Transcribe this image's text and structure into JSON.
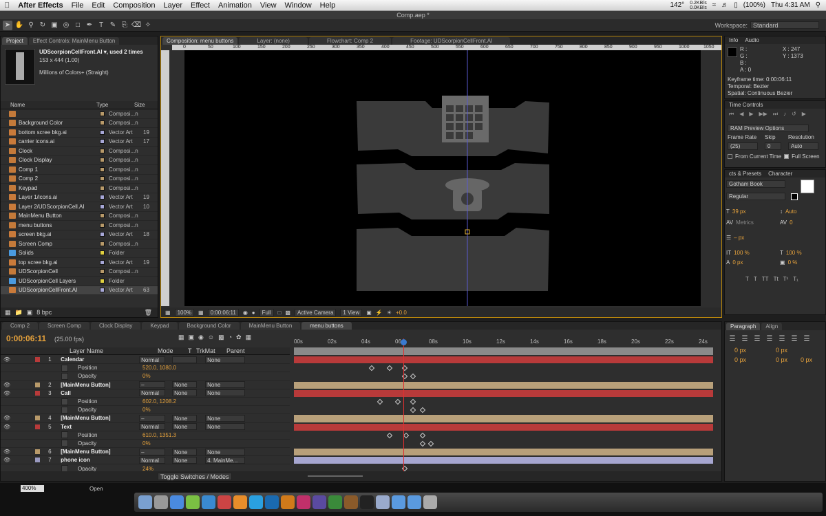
{
  "menubar": {
    "app_name": "After Effects",
    "items": [
      "File",
      "Edit",
      "Composition",
      "Layer",
      "Effect",
      "Animation",
      "View",
      "Window",
      "Help"
    ],
    "temp": "142°",
    "net_up": "0.2KB/s",
    "net_down": "0.0KB/s",
    "battery": "(100%)",
    "clock": "Thu 4:31 AM"
  },
  "window_title": "Comp.aep *",
  "workspace": {
    "label": "Workspace:",
    "value": "Standard"
  },
  "project": {
    "tabs": [
      "Project",
      "Effect Controls: MainMenu Button"
    ],
    "preview_name": "UDScorpionCellFront.AI ▾, used 2 times",
    "preview_dims": "153 x 444 (1.00)",
    "preview_color": "Millions of Colors+ (Straight)",
    "columns": {
      "name": "Name",
      "type": "Type",
      "size": "Size"
    },
    "items": [
      {
        "name": "",
        "type": "Composi...n",
        "size": "",
        "kind": "comp"
      },
      {
        "name": "Background Color",
        "type": "Composi...n",
        "size": "",
        "kind": "comp"
      },
      {
        "name": "bottom scree bkg.ai",
        "type": "Vector Art",
        "size": "19",
        "kind": "ai"
      },
      {
        "name": "carrier icons.ai",
        "type": "Vector Art",
        "size": "17",
        "kind": "ai"
      },
      {
        "name": "Clock",
        "type": "Composi...n",
        "size": "",
        "kind": "comp"
      },
      {
        "name": "Clock Display",
        "type": "Composi...n",
        "size": "",
        "kind": "comp"
      },
      {
        "name": "Comp 1",
        "type": "Composi...n",
        "size": "",
        "kind": "comp"
      },
      {
        "name": "Comp 2",
        "type": "Composi...n",
        "size": "",
        "kind": "comp"
      },
      {
        "name": "Keypad",
        "type": "Composi...n",
        "size": "",
        "kind": "comp"
      },
      {
        "name": "Layer 1/icons.ai",
        "type": "Vector Art",
        "size": "19",
        "kind": "ai"
      },
      {
        "name": "Layer 2/UDScorpionCell.AI",
        "type": "Vector Art",
        "size": "10",
        "kind": "ai"
      },
      {
        "name": "MainMenu Button",
        "type": "Composi...n",
        "size": "",
        "kind": "comp"
      },
      {
        "name": "menu buttons",
        "type": "Composi...n",
        "size": "",
        "kind": "comp"
      },
      {
        "name": "screen bkg.ai",
        "type": "Vector Art",
        "size": "18",
        "kind": "ai"
      },
      {
        "name": "Screen Comp",
        "type": "Composi...n",
        "size": "",
        "kind": "comp"
      },
      {
        "name": "Solids",
        "type": "Folder",
        "size": "",
        "kind": "folder"
      },
      {
        "name": "top scree bkg.ai",
        "type": "Vector Art",
        "size": "19",
        "kind": "ai"
      },
      {
        "name": "UDScorpionCell",
        "type": "Composi...n",
        "size": "",
        "kind": "comp"
      },
      {
        "name": "UDScorpionCell Layers",
        "type": "Folder",
        "size": "",
        "kind": "folder"
      },
      {
        "name": "UDScorpionCellFront.AI",
        "type": "Vector Art",
        "size": "63",
        "kind": "ai"
      }
    ],
    "bpc": "8 bpc"
  },
  "viewer": {
    "tabs": [
      "Composition: menu buttons",
      "Layer: (none)",
      "Flowchart: Comp 2",
      "Footage: UDScorpionCellFront.AI"
    ],
    "ruler": [
      "0",
      "50",
      "100",
      "150",
      "200",
      "250",
      "300",
      "350",
      "400",
      "450",
      "500",
      "550",
      "600",
      "650",
      "700",
      "750",
      "800",
      "850",
      "900",
      "950",
      "1000",
      "1050"
    ],
    "zoom": "100%",
    "timecode": "0:00:06:11",
    "resolution": "Full",
    "camera": "Active Camera",
    "views": "1 View",
    "exposure": "+0.0"
  },
  "info": {
    "tabs": [
      "Info",
      "Audio"
    ],
    "r": "R :",
    "g": "G :",
    "b": "B :",
    "a": "A : 0",
    "x": "X : 247",
    "y": "Y : 1373",
    "keyframe_time": "Keyframe time: 0:00:06:11",
    "temporal": "Temporal: Bezier",
    "spatial": "Spatial: Continuous Bezier"
  },
  "time_controls": {
    "title": "Time Controls",
    "ram_preview": "RAM Preview Options",
    "frame_rate_label": "Frame Rate",
    "frame_rate": "(25)",
    "skip_label": "Skip",
    "skip": "0",
    "resolution_label": "Resolution",
    "resolution": "Auto",
    "from_current": "From Current Time",
    "full_screen": "Full Screen"
  },
  "character": {
    "tabs": [
      "cts & Presets",
      "Character"
    ],
    "font": "Gotham Book",
    "style": "Regular",
    "size": "39 px",
    "leading": "Auto",
    "kerning": "Metrics",
    "tracking": "0",
    "stroke": "– px",
    "vscale": "100 %",
    "hscale": "100 %",
    "baseline": "0 px",
    "tsume": "0 %"
  },
  "paragraph": {
    "tabs": [
      "Paragraph",
      "Align"
    ],
    "indent_left": "0 px",
    "indent_right": "0 px",
    "indent_first": "0 px",
    "space_before": "0 px",
    "space_after": "0 px"
  },
  "timeline": {
    "tabs": [
      "Comp 2",
      "Screen Comp",
      "Clock Display",
      "Keypad",
      "Background Color",
      "MainMenu Button",
      "menu buttons"
    ],
    "timecode": "0:00:06:11",
    "fps": "(25.00 fps)",
    "columns": {
      "layer_name": "Layer Name",
      "mode": "Mode",
      "t": "T",
      "trkmat": "TrkMat",
      "parent": "Parent"
    },
    "ruler": [
      "00s",
      "02s",
      "04s",
      "06s",
      "08s",
      "10s",
      "12s",
      "14s",
      "16s",
      "18s",
      "20s",
      "22s",
      "24s"
    ],
    "toggle": "Toggle Switches / Modes",
    "layers": [
      {
        "num": "1",
        "name": "Calendar",
        "mode": "Normal",
        "trk": "",
        "parent": "None",
        "color": "#b83a3a",
        "bar": "#b83a3a"
      },
      {
        "prop": true,
        "name": "Position",
        "value": "520.0, 1080.0"
      },
      {
        "prop": true,
        "name": "Opacity",
        "value": "0%"
      },
      {
        "num": "2",
        "name": "[MainMenu Button]",
        "mode": "–",
        "trk": "None",
        "parent": "None",
        "color": "#b89a6a",
        "bar": "#b8a07a"
      },
      {
        "num": "3",
        "name": "Call",
        "mode": "Normal",
        "trk": "None",
        "parent": "None",
        "color": "#b83a3a",
        "bar": "#b83a3a"
      },
      {
        "prop": true,
        "name": "Position",
        "value": "602.0, 1208.2"
      },
      {
        "prop": true,
        "name": "Opacity",
        "value": "0%"
      },
      {
        "num": "4",
        "name": "[MainMenu Button]",
        "mode": "–",
        "trk": "None",
        "parent": "None",
        "color": "#b89a6a",
        "bar": "#b8a07a"
      },
      {
        "num": "5",
        "name": "Text",
        "mode": "Normal",
        "trk": "None",
        "parent": "None",
        "color": "#b83a3a",
        "bar": "#b83a3a"
      },
      {
        "prop": true,
        "name": "Position",
        "value": "610.0, 1351.3"
      },
      {
        "prop": true,
        "name": "Opacity",
        "value": "0%"
      },
      {
        "num": "6",
        "name": "[MainMenu Button]",
        "mode": "–",
        "trk": "None",
        "parent": "None",
        "color": "#b89a6a",
        "bar": "#b8a07a"
      },
      {
        "num": "7",
        "name": "phone icon",
        "mode": "Normal",
        "trk": "None",
        "parent": "4. MainMe...",
        "color": "#9a9ac0",
        "bar": "#a6a6d0"
      },
      {
        "prop": true,
        "name": "Opacity",
        "value": "24%"
      }
    ]
  },
  "statusbar": {
    "zoom": "400%",
    "open": "Open"
  }
}
